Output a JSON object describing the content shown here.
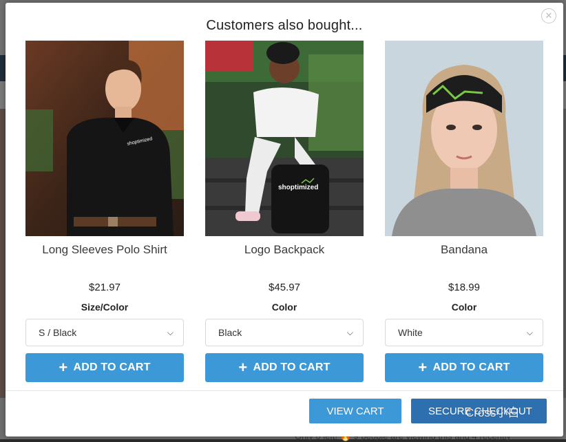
{
  "modal": {
    "title": "Customers also bought...",
    "close_icon": "close-icon"
  },
  "products": [
    {
      "name": "Long Sleeves Polo Shirt",
      "price": "$21.97",
      "option_label": "Size/Color",
      "option_value": "S / Black",
      "button": "ADD TO CART",
      "logo": "shoptimized"
    },
    {
      "name": "Logo Backpack",
      "price": "$45.97",
      "option_label": "Color",
      "option_value": "Black",
      "button": "ADD TO CART",
      "logo": "shoptimized"
    },
    {
      "name": "Bandana",
      "price": "$18.99",
      "option_label": "Color",
      "option_value": "White",
      "button": "ADD TO CART"
    }
  ],
  "footer": {
    "view_cart": "VIEW CART",
    "secure_checkout": "SECURE CHECKOUT"
  },
  "background": {
    "bottom_text": "Only 0 left! 🔥 9 people are viewing this and 4 recently"
  },
  "watermark": "Cross小白",
  "colors": {
    "button_blue": "#3c98d6",
    "checkout_blue": "#2e6fb0"
  }
}
